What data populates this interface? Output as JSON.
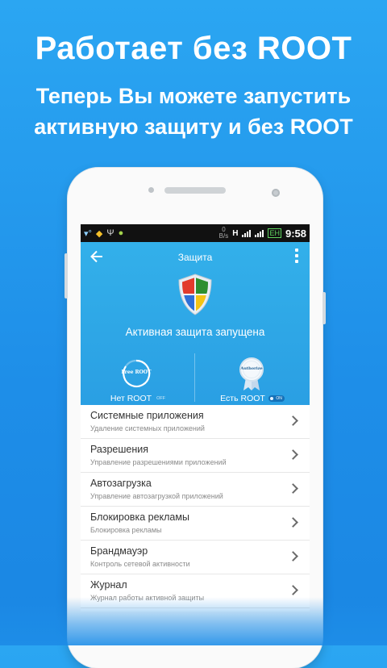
{
  "promo": {
    "headline": "Работает без ROOT",
    "subline_1": "Теперь Вы можете запустить",
    "subline_2": "активную защиту и без ROOT"
  },
  "statusbar": {
    "speed_value": "0",
    "speed_unit": "B/s",
    "network": "H",
    "lang": "EH",
    "time": "9:58"
  },
  "app": {
    "title": "Защита",
    "status": "Активная защита запущена",
    "modes": [
      {
        "badge_text": "Free ROOT",
        "label": "Нет ROOT",
        "toggle": "OFF"
      },
      {
        "badge_text": "Authorize",
        "label": "Есть ROOT",
        "toggle": "ON"
      }
    ],
    "items": [
      {
        "title": "Системные приложения",
        "subtitle": "Удаление системных приложений"
      },
      {
        "title": "Разрешения",
        "subtitle": "Управление разрешениями приложений"
      },
      {
        "title": "Автозагрузка",
        "subtitle": "Управление автозагрузкой приложений"
      },
      {
        "title": "Блокировка рекламы",
        "subtitle": "Блокировка рекламы"
      },
      {
        "title": "Брандмауэр",
        "subtitle": "Контроль сетевой активности"
      },
      {
        "title": "Журнал",
        "subtitle": "Журнал работы активной защиты"
      }
    ]
  },
  "colors": {
    "background": "#1e8ee8",
    "header": "#2ea6e6",
    "white": "#ffffff"
  }
}
